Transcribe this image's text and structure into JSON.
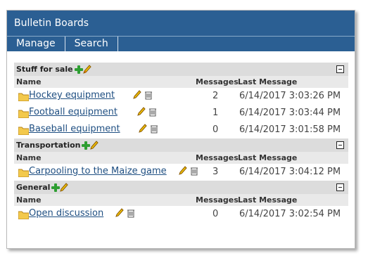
{
  "app": {
    "title": "Bulletin Boards"
  },
  "menu": {
    "manage": "Manage",
    "search": "Search"
  },
  "columns": {
    "name": "Name",
    "messages": "Messages",
    "last": "Last Message"
  },
  "sections": [
    {
      "title": "Stuff for sale",
      "rows": [
        {
          "name": "Hockey equipment",
          "messages": "2",
          "last": "6/14/2017 3:03:26 PM"
        },
        {
          "name": "Football equipment",
          "messages": "1",
          "last": "6/14/2017 3:03:44 PM"
        },
        {
          "name": "Baseball equipment",
          "messages": "0",
          "last": "6/14/2017 3:01:58 PM"
        }
      ]
    },
    {
      "title": "Transportation",
      "rows": [
        {
          "name": "Carpooling to the Maize game",
          "messages": "3",
          "last": "6/14/2017 3:04:12 PM"
        }
      ]
    },
    {
      "title": "General",
      "rows": [
        {
          "name": "Open discussion",
          "messages": "0",
          "last": "6/14/2017 3:02:54 PM"
        }
      ]
    }
  ]
}
